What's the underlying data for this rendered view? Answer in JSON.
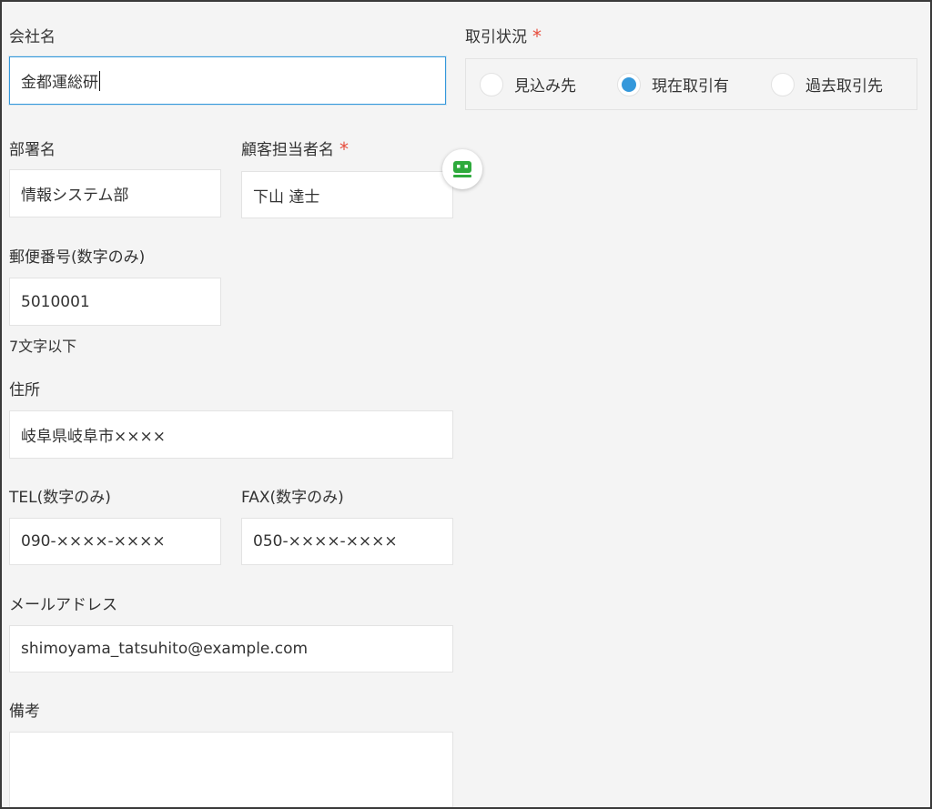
{
  "form": {
    "company": {
      "label": "会社名",
      "value": "金都運総研"
    },
    "status": {
      "label": "取引状況",
      "required_mark": "*",
      "options": [
        {
          "label": "見込み先",
          "selected": false
        },
        {
          "label": "現在取引有",
          "selected": true
        },
        {
          "label": "過去取引先",
          "selected": false
        }
      ]
    },
    "department": {
      "label": "部署名",
      "value": "情報システム部"
    },
    "contact": {
      "label": "顧客担当者名",
      "required_mark": "*",
      "value": "下山 達士"
    },
    "postal": {
      "label": "郵便番号(数字のみ)",
      "value": "5010001",
      "hint": "7文字以下"
    },
    "address": {
      "label": "住所",
      "value": "岐阜県岐阜市××××"
    },
    "tel": {
      "label": "TEL(数字のみ)",
      "value": "090-××××-××××"
    },
    "fax": {
      "label": "FAX(数字のみ)",
      "value": "050-××××-××××"
    },
    "email": {
      "label": "メールアドレス",
      "value": "shimoyama_tatsuhito@example.com"
    },
    "notes": {
      "label": "備考",
      "value": ""
    }
  },
  "icons": {
    "assistant": "robot-icon"
  },
  "colors": {
    "accent": "#3498db",
    "required": "#e74c3c",
    "robot": "#2eaa3c",
    "background": "#f4f4f4"
  }
}
